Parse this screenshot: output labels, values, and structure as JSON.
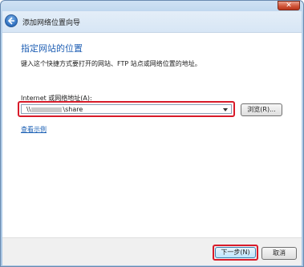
{
  "window": {
    "title": "添加网络位置向导",
    "close_symbol": "✕"
  },
  "page": {
    "heading": "指定网站的位置",
    "instruction": "键入这个快捷方式要打开的网站、FTP 站点或网络位置的地址。",
    "address_label": "Internet 或网络地址(A):",
    "address_value_prefix": "\\\\",
    "address_value_suffix": "\\share",
    "browse_label": "浏览(R)...",
    "example_link": "查看示例"
  },
  "footer": {
    "next_label": "下一步(N)",
    "cancel_label": "取消"
  },
  "colors": {
    "highlight": "#d81b2a",
    "heading": "#1f5fb4",
    "link": "#1a5fb4"
  }
}
